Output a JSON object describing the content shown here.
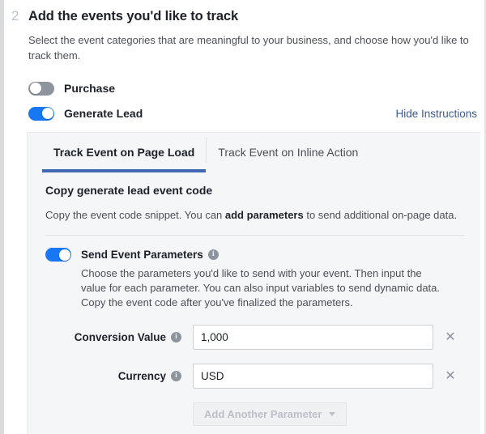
{
  "step": {
    "number": "2",
    "title": "Add the events you'd like to track",
    "description": "Select the event categories that are meaningful to your business, and choose how you'd like to track them."
  },
  "events": [
    {
      "label": "Purchase",
      "enabled": false
    },
    {
      "label": "Generate Lead",
      "enabled": true
    }
  ],
  "hide_instructions_label": "Hide Instructions",
  "tabs": [
    {
      "label": "Track Event on Page Load",
      "active": true
    },
    {
      "label": "Track Event on Inline Action",
      "active": false
    }
  ],
  "panel": {
    "heading": "Copy generate lead event code",
    "description_prefix": "Copy the event code snippet. You can ",
    "description_bold": "add parameters",
    "description_suffix": " to send additional on-page data."
  },
  "send_parameters": {
    "title": "Send Event Parameters",
    "enabled": true,
    "description": "Choose the parameters you'd like to send with your event. Then input the value for each parameter. You can also input variables to send dynamic data. Copy the event code after you've finalized the parameters.",
    "info_icon": "info-icon"
  },
  "parameters": [
    {
      "label": "Conversion Value",
      "value": "1,000",
      "placeholder": "",
      "info_icon": "info-icon",
      "remove_icon": "close-icon"
    },
    {
      "label": "Currency",
      "value": "USD",
      "placeholder": "",
      "info_icon": "info-icon",
      "remove_icon": "close-icon"
    }
  ],
  "add_parameter": {
    "label": "Add Another Parameter",
    "caret_icon": "chevron-down-icon",
    "disabled": true
  },
  "colors": {
    "accent_blue": "#1877f2",
    "tab_underline": "#4267b2",
    "link_blue": "#3b5998",
    "panel_bg": "#f5f6f7",
    "text_primary": "#1d2129",
    "text_secondary": "#4b4f56",
    "toggle_off": "#8d949e"
  }
}
